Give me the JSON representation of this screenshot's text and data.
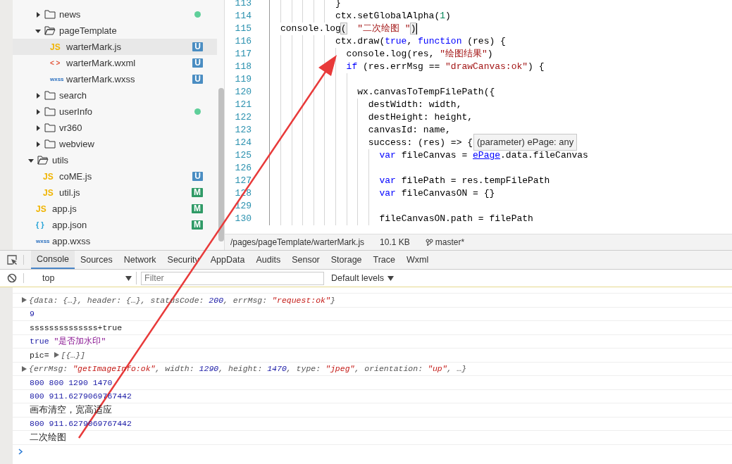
{
  "file_tree": {
    "partial_children": [
      {
        "label": "news",
        "kind": "folder",
        "expanded": false,
        "selected": false,
        "modified": true
      },
      {
        "label": "pageTemplate",
        "kind": "folder",
        "expanded": true,
        "selected": false,
        "modified": false,
        "children": [
          {
            "label": "warterMark.js",
            "kind": "js",
            "icon": "JS",
            "selected": true,
            "modified": false,
            "badge": "U",
            "color": "#4a8dc2"
          },
          {
            "label": "warterMark.wxml",
            "kind": "wxml",
            "icon": "< >",
            "selected": false,
            "modified": false,
            "badge": "U",
            "color": "#4a8dc2"
          },
          {
            "label": "warterMark.wxss",
            "kind": "wxss",
            "icon": "wxss",
            "selected": false,
            "modified": false,
            "badge": "U",
            "color": "#4a8dc2"
          }
        ]
      },
      {
        "label": "search",
        "kind": "folder",
        "expanded": false,
        "selected": false,
        "modified": false
      },
      {
        "label": "userInfo",
        "kind": "folder",
        "expanded": false,
        "selected": false,
        "modified": true
      },
      {
        "label": "vr360",
        "kind": "folder",
        "expanded": false,
        "selected": false,
        "modified": false
      },
      {
        "label": "webview",
        "kind": "folder",
        "expanded": false,
        "selected": false,
        "modified": false
      }
    ],
    "items": [
      {
        "label": "utils",
        "kind": "folder",
        "expanded": true,
        "selected": false,
        "modified": false,
        "children": [
          {
            "label": "coME.js",
            "kind": "js",
            "icon": "JS",
            "selected": false,
            "modified": false,
            "badge": "U",
            "color": "#4a8dc2"
          },
          {
            "label": "util.js",
            "kind": "js",
            "icon": "JS",
            "selected": false,
            "modified": false,
            "badge": "M",
            "color": "#2f9a66"
          }
        ]
      },
      {
        "label": "app.js",
        "kind": "js",
        "icon": "JS",
        "selected": false,
        "modified": false,
        "badge": "M",
        "color": "#2f9a66"
      },
      {
        "label": "app.json",
        "kind": "json",
        "icon": "{ }",
        "selected": false,
        "modified": false,
        "badge": "M",
        "color": "#2f9a66"
      },
      {
        "label": "app.wxss",
        "kind": "wxss",
        "icon": "wxss",
        "selected": false,
        "modified": false
      }
    ]
  },
  "editor": {
    "lines": [
      {
        "number": "113",
        "cursor": false,
        "segments": [
          {
            "kind": "plain",
            "text": "}"
          }
        ]
      },
      {
        "number": "114",
        "cursor": false,
        "segments": [
          {
            "kind": "plain",
            "text": "ctx.setGlobalAlpha("
          },
          {
            "kind": "number",
            "text": "1"
          },
          {
            "kind": "plain",
            "text": ")"
          }
        ]
      },
      {
        "number": "115",
        "cursor": true,
        "segments": [
          {
            "kind": "plain",
            "text": "console.log"
          },
          {
            "kind": "bracket",
            "text": "("
          },
          {
            "kind": "string",
            "text": "\"二次绘图 \""
          },
          {
            "kind": "bracket",
            "text": ")"
          }
        ]
      },
      {
        "number": "116",
        "cursor": false,
        "segments": [
          {
            "kind": "plain",
            "text": "ctx.draw("
          },
          {
            "kind": "keyword",
            "text": "true"
          },
          {
            "kind": "plain",
            "text": ", "
          },
          {
            "kind": "keyword",
            "text": "function"
          },
          {
            "kind": "plain",
            "text": " (res) {"
          }
        ]
      },
      {
        "number": "117",
        "cursor": false,
        "segments": [
          {
            "kind": "plain",
            "text": "console.log(res, "
          },
          {
            "kind": "string",
            "text": "\"绘图结果\""
          },
          {
            "kind": "plain",
            "text": ")"
          }
        ]
      },
      {
        "number": "118",
        "cursor": false,
        "segments": [
          {
            "kind": "keyword",
            "text": "if"
          },
          {
            "kind": "plain",
            "text": " (res.errMsg == "
          },
          {
            "kind": "string",
            "text": "\"drawCanvas:ok\""
          },
          {
            "kind": "plain",
            "text": ") {"
          }
        ]
      },
      {
        "number": "119",
        "cursor": false
      },
      {
        "number": "120",
        "cursor": false,
        "segments": [
          {
            "kind": "plain",
            "text": "wx.canvasToTempFilePath({"
          }
        ]
      },
      {
        "number": "121",
        "cursor": false,
        "segments": [
          {
            "kind": "plain",
            "text": "destWidth: width,"
          }
        ]
      },
      {
        "number": "122",
        "cursor": false,
        "segments": [
          {
            "kind": "plain",
            "text": "destHeight: height,"
          }
        ]
      },
      {
        "number": "123",
        "cursor": false,
        "segments": [
          {
            "kind": "plain",
            "text": "canvasId: name,"
          }
        ]
      },
      {
        "number": "124",
        "cursor": false,
        "segments": [
          {
            "kind": "plain",
            "text": "success: (res) => {"
          }
        ]
      },
      {
        "number": "125",
        "cursor": false,
        "segments": [
          {
            "kind": "keyword",
            "text": "var"
          },
          {
            "kind": "plain",
            "text": " fileCanvas = "
          },
          {
            "kind": "link",
            "text": "ePage"
          },
          {
            "kind": "plain",
            "text": ".data.fileCanvas"
          }
        ]
      },
      {
        "number": "126",
        "cursor": false
      },
      {
        "number": "127",
        "cursor": false,
        "segments": [
          {
            "kind": "keyword",
            "text": "var"
          },
          {
            "kind": "plain",
            "text": " filePath = res.tempFilePath"
          }
        ]
      },
      {
        "number": "128",
        "cursor": false,
        "segments": [
          {
            "kind": "keyword",
            "text": "var"
          },
          {
            "kind": "plain",
            "text": " fileCanvasON = {}"
          }
        ]
      },
      {
        "number": "129",
        "cursor": false
      },
      {
        "number": "130",
        "cursor": false,
        "segments": [
          {
            "kind": "plain",
            "text": "fileCanvasON.path = filePath"
          }
        ]
      }
    ],
    "tooltip": "(parameter) ePage: any"
  },
  "status_bar": {
    "path": "/pages/pageTemplate/warterMark.js",
    "size": "10.1 KB",
    "branch": "master*"
  },
  "devtools": {
    "tabs": [
      {
        "label": "Console",
        "selected": true
      },
      {
        "label": "Sources",
        "selected": false
      },
      {
        "label": "Network",
        "selected": false
      },
      {
        "label": "Security",
        "selected": false
      },
      {
        "label": "AppData",
        "selected": false
      },
      {
        "label": "Audits",
        "selected": false
      },
      {
        "label": "Sensor",
        "selected": false
      },
      {
        "label": "Storage",
        "selected": false
      },
      {
        "label": "Trace",
        "selected": false
      },
      {
        "label": "Wxml",
        "selected": false
      }
    ],
    "context": "top",
    "filter_placeholder": "Filter",
    "levels": "Default levels"
  },
  "console": {
    "rows": [
      {
        "expandable": true,
        "segments": [
          {
            "kind": "obj",
            "text": "{data: {…}, header: {…}, statusCode: "
          },
          {
            "kind": "obj-num",
            "text": "200"
          },
          {
            "kind": "obj",
            "text": ", errMsg: "
          },
          {
            "kind": "obj-str",
            "text": "\"request:ok\""
          },
          {
            "kind": "obj",
            "text": "}"
          }
        ]
      },
      {
        "expandable": false,
        "segments": [
          {
            "kind": "num",
            "text": "9"
          }
        ]
      },
      {
        "expandable": false,
        "segments": [
          {
            "kind": "text",
            "text": "ssssssssssssss+true"
          }
        ]
      },
      {
        "expandable": false,
        "segments": [
          {
            "kind": "num",
            "text": "true"
          },
          {
            "kind": "str",
            "text": "\"是否加水印\""
          }
        ]
      },
      {
        "expandable": false,
        "segments": [
          {
            "kind": "text",
            "text": "pic="
          },
          {
            "kind": "expander"
          },
          {
            "kind": "obj",
            "text": "[{…}]"
          }
        ]
      },
      {
        "expandable": true,
        "segments": [
          {
            "kind": "obj",
            "text": "{errMsg: "
          },
          {
            "kind": "obj-str",
            "text": "\"getImageInfo:ok\""
          },
          {
            "kind": "obj",
            "text": ", width: "
          },
          {
            "kind": "obj-num",
            "text": "1290"
          },
          {
            "kind": "obj",
            "text": ", height: "
          },
          {
            "kind": "obj-num",
            "text": "1470"
          },
          {
            "kind": "obj",
            "text": ", type: "
          },
          {
            "kind": "obj-str",
            "text": "\"jpeg\""
          },
          {
            "kind": "obj",
            "text": ", orientation: "
          },
          {
            "kind": "obj-str",
            "text": "\"up\""
          },
          {
            "kind": "obj",
            "text": ", …}"
          }
        ]
      },
      {
        "expandable": false,
        "segments": [
          {
            "kind": "num",
            "text": "800 800 1290 1470"
          }
        ]
      },
      {
        "expandable": false,
        "segments": [
          {
            "kind": "num",
            "text": "800 911.6279069767442"
          }
        ]
      },
      {
        "expandable": false,
        "segments": [
          {
            "kind": "text",
            "text": "画布清空，宽高适应"
          }
        ]
      },
      {
        "expandable": false,
        "segments": [
          {
            "kind": "num",
            "text": "800 911.6279069767442"
          }
        ]
      },
      {
        "expandable": false,
        "segments": [
          {
            "kind": "text",
            "text": "二次绘图"
          }
        ]
      }
    ]
  }
}
